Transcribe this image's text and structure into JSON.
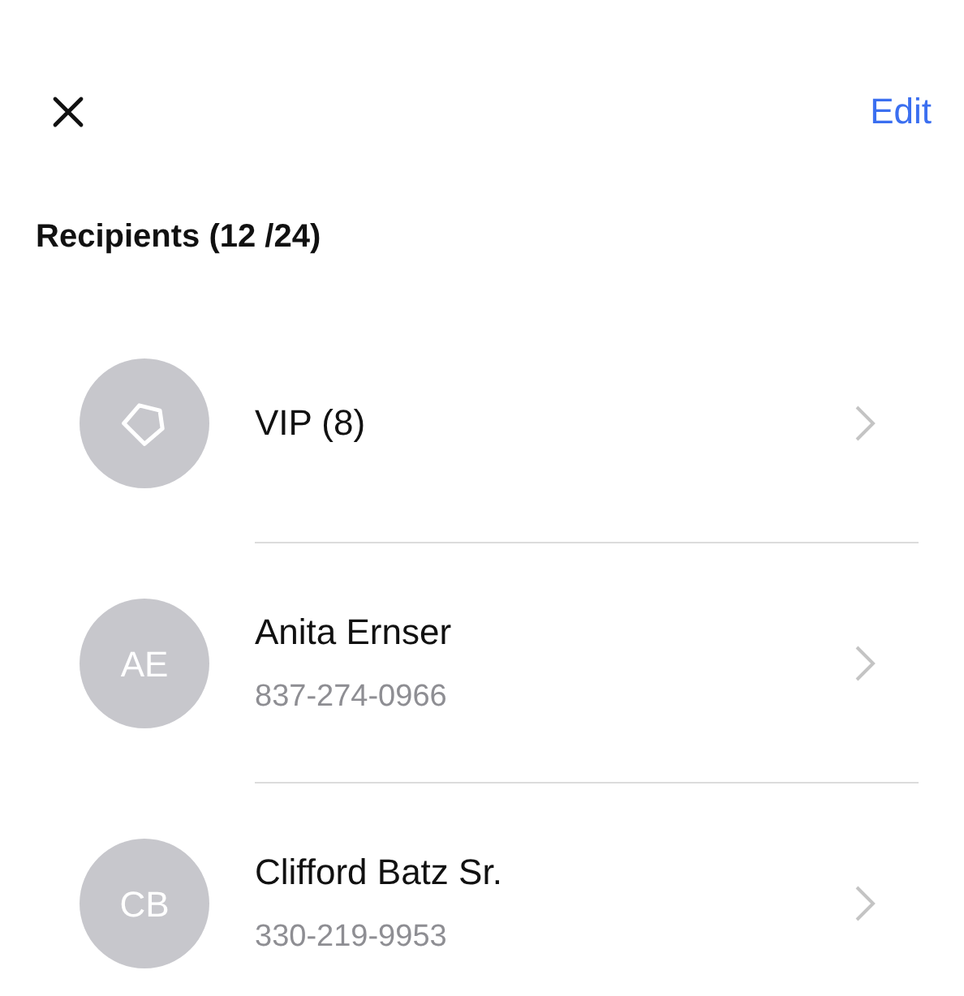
{
  "header": {
    "action": "Edit"
  },
  "section": {
    "title": "Recipients (12 /24)"
  },
  "recipients": [
    {
      "kind": "group",
      "name": "VIP (8)"
    },
    {
      "kind": "contact",
      "initials": "AE",
      "name": "Anita Ernser",
      "phone": "837-274-0966"
    },
    {
      "kind": "contact",
      "initials": "CB",
      "name": "Clifford Batz Sr.",
      "phone": "330-219-9953"
    }
  ]
}
